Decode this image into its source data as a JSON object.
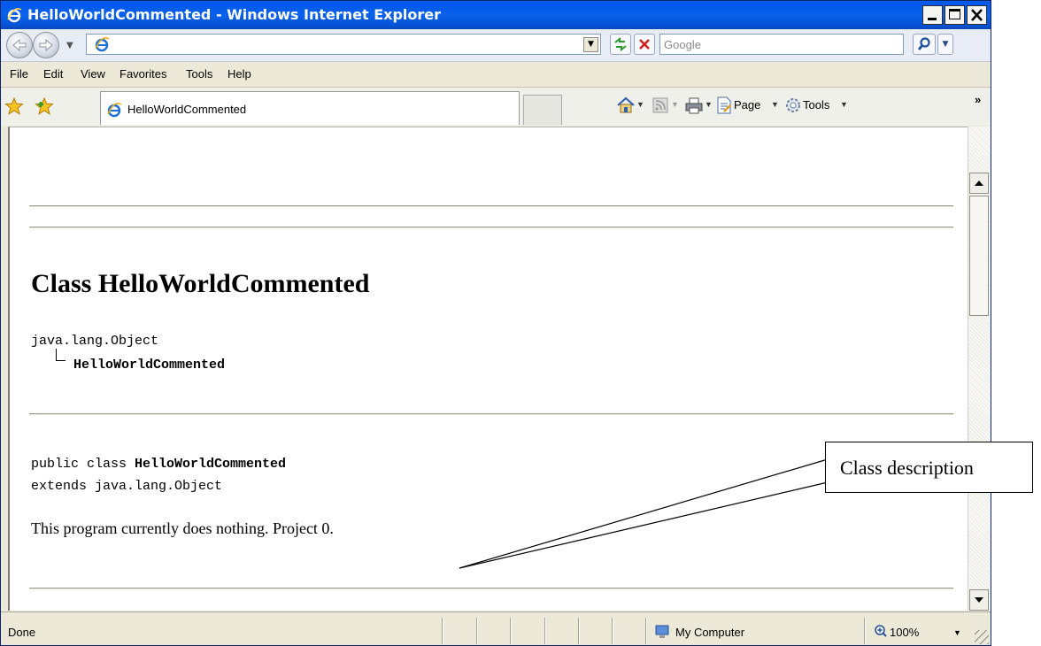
{
  "window": {
    "title": "HelloWorldCommented - Windows Internet Explorer",
    "minimize_glyph": "_",
    "maximize_glyph": "□",
    "close_glyph": "×"
  },
  "address_bar": {
    "url": "",
    "search_placeholder": "Google"
  },
  "menu": {
    "items": [
      {
        "label": "File"
      },
      {
        "label": "Edit"
      },
      {
        "label": "View"
      },
      {
        "label": "Favorites"
      },
      {
        "label": "Tools"
      },
      {
        "label": "Help"
      }
    ]
  },
  "favorites_bar": {
    "tab_label": "HelloWorldCommented",
    "page_label": "Page",
    "tools_label": "Tools",
    "overflow_glyph": "»"
  },
  "document": {
    "title": "Class HelloWorldCommented",
    "hierarchy_parent": "java.lang.Object",
    "hierarchy_child": "HelloWorldCommented",
    "declaration_prefix": "public class ",
    "declaration_name": "HelloWorldCommented",
    "declaration_extends": "extends java.lang.Object",
    "description": "This program currently does nothing. Project 0."
  },
  "status_bar": {
    "status": "Done",
    "zone": "My Computer",
    "zoom": "100%"
  },
  "annotation": {
    "label": "Class description"
  },
  "colors": {
    "titlebar": "#0058ee",
    "chrome": "#ece9d8",
    "stop_red": "#d02020",
    "refresh_green": "#2a9a2a"
  }
}
